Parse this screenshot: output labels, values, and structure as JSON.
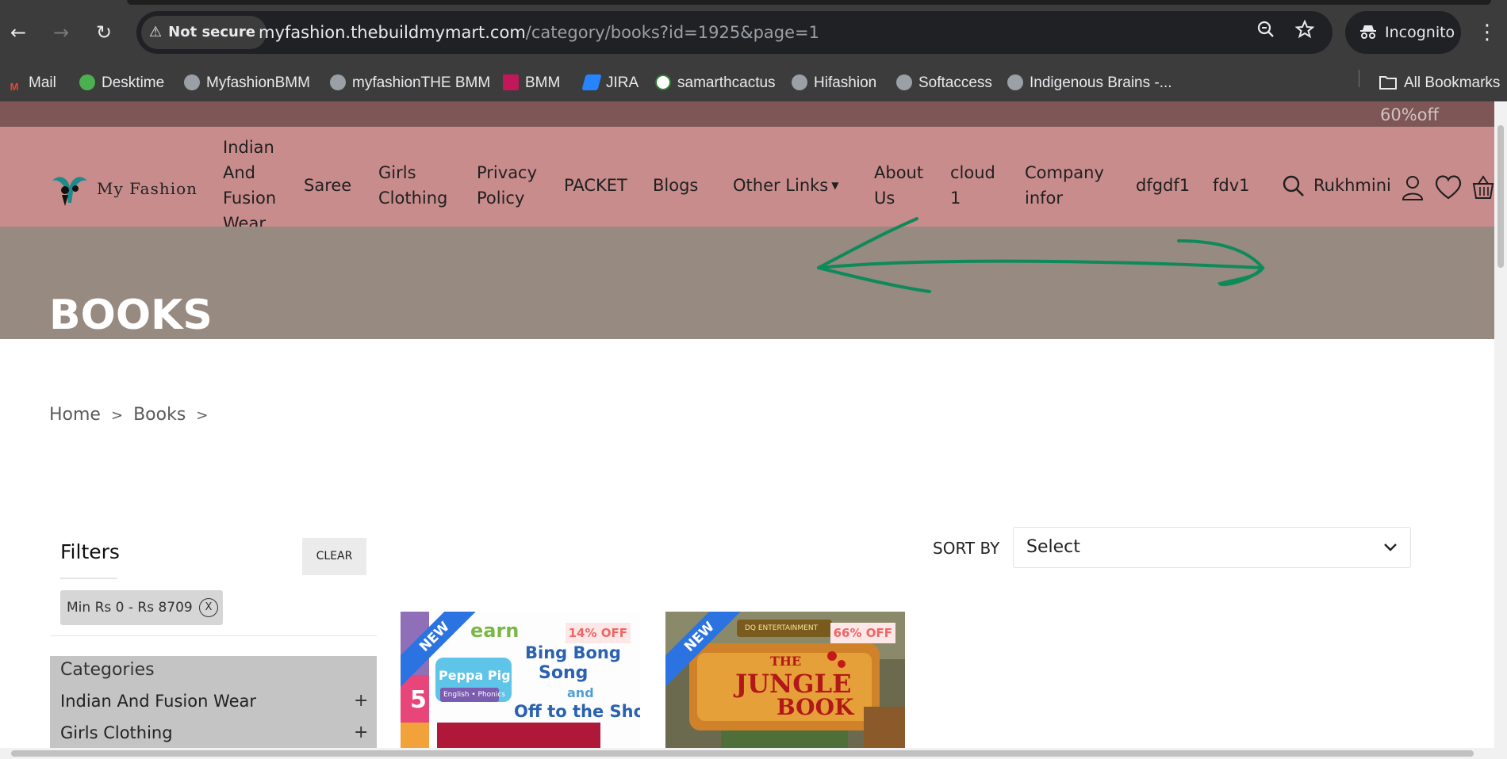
{
  "browser": {
    "back_glyph": "←",
    "forward_glyph": "→",
    "reload_glyph": "↻",
    "security_warning_glyph": "⚠",
    "security_label": "Not secure",
    "url_host": "myfashion.thebuildmymart.com",
    "url_path": "/category/books?id=1925&page=1",
    "zoom_icon": "zoom-icon",
    "star_icon": "bookmark-star-icon",
    "incognito_label": "Incognito",
    "menu_glyph": "⋮"
  },
  "bookmarks": [
    {
      "label": "Mail",
      "icon": "gmail-icon",
      "color": "#ea4335",
      "glyph": "M"
    },
    {
      "label": "Desktime",
      "icon": "desktime-icon",
      "color": "#4caf50",
      "glyph": ""
    },
    {
      "label": "MyfashionBMM",
      "icon": "globe-icon",
      "color": "#9aa0a6",
      "glyph": ""
    },
    {
      "label": "myfashionTHE BMM",
      "icon": "globe-icon",
      "color": "#9aa0a6",
      "glyph": ""
    },
    {
      "label": "BMM",
      "icon": "bmm-icon",
      "color": "#c2185b",
      "glyph": ""
    },
    {
      "label": "JIRA",
      "icon": "jira-icon",
      "color": "#2684ff",
      "glyph": ""
    },
    {
      "label": "samarthcactus",
      "icon": "cactus-icon",
      "color": "#2e7d32",
      "glyph": ""
    },
    {
      "label": "Hifashion",
      "icon": "globe-icon",
      "color": "#9aa0a6",
      "glyph": ""
    },
    {
      "label": "Softaccess",
      "icon": "globe-icon",
      "color": "#9aa0a6",
      "glyph": ""
    },
    {
      "label": "Indigenous Brains -...",
      "icon": "globe-icon",
      "color": "#9aa0a6",
      "glyph": ""
    }
  ],
  "all_bookmarks_label": "All Bookmarks",
  "site": {
    "promo": "60%off",
    "logo_text": "My Fashion",
    "nav": [
      "Indian\nAnd\nFusion\nWear",
      "Saree",
      "Girls\nClothing",
      "Privacy\nPolicy",
      "PACKET",
      "Blogs",
      "Other Links",
      "About\nUs",
      "cloud\n1",
      "Company\ninfor",
      "dfgdf1",
      "fdv1"
    ],
    "user_name": "Rukhmini",
    "page_title": "BOOKS",
    "breadcrumb": [
      "Home",
      "Books"
    ],
    "breadcrumb_sep": ">",
    "filters_title": "Filters",
    "clear_label": "CLEAR",
    "price_chip": "Min Rs 0 - Rs 8709",
    "chip_close": "X",
    "categories_title": "Categories",
    "categories": [
      "Indian And Fusion Wear",
      "Girls Clothing"
    ],
    "plus": "+",
    "sort_label": "SORT BY",
    "sort_value": "Select",
    "products": [
      {
        "badge": "NEW",
        "discount": "14% OFF",
        "cover_line1": "Bing Bong",
        "cover_line2": "Song",
        "cover_line3": "and",
        "cover_line4": "Off to the Shop",
        "cover_top": "earn",
        "cover_brand": "Peppa Pig",
        "cover_sub": "English • Phonics",
        "cover_num": "5"
      },
      {
        "badge": "NEW",
        "discount": "66% OFF",
        "cover_top": "DQ ENTERTAINMENT",
        "cover_title_1": "THE",
        "cover_title_2": "JUNGLE",
        "cover_title_3": "BOOK"
      }
    ]
  },
  "colors": {
    "promo_bg": "#7e5656",
    "nav_bg": "#c98c8c",
    "hero_bg": "#978a80",
    "annotation_arrow": "#0e8a5a",
    "badge_blue": "#2a73e0",
    "discount_text": "#e66666"
  }
}
